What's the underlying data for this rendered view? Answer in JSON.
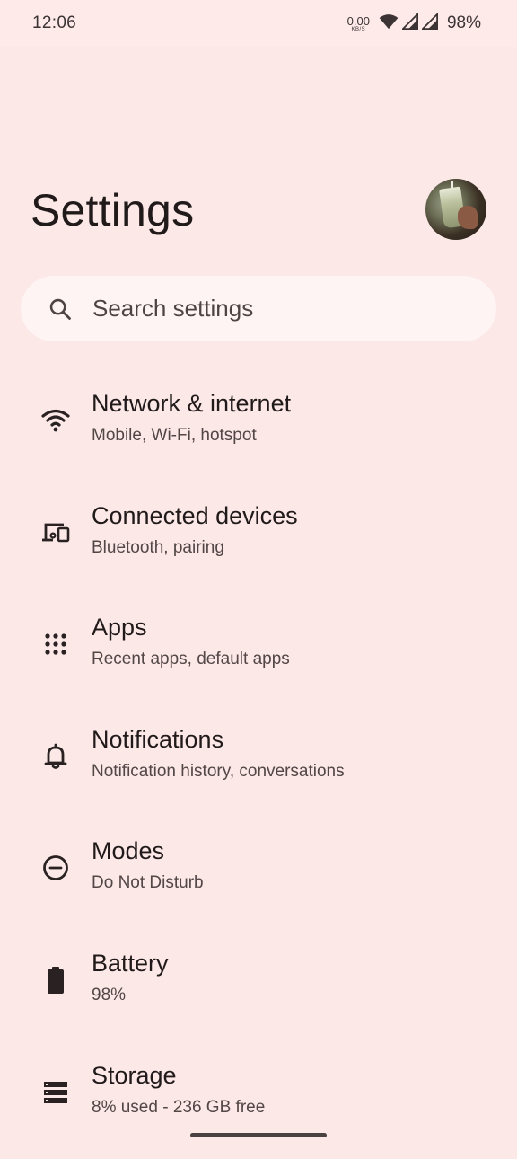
{
  "status_bar": {
    "time": "12:06",
    "net_speed": "0.00",
    "net_speed_unit": "KB/S",
    "battery": "98%"
  },
  "header": {
    "title": "Settings"
  },
  "search": {
    "placeholder": "Search settings"
  },
  "items": [
    {
      "title": "Network & internet",
      "subtitle": "Mobile, Wi-Fi, hotspot",
      "icon": "wifi-icon"
    },
    {
      "title": "Connected devices",
      "subtitle": "Bluetooth, pairing",
      "icon": "devices-icon"
    },
    {
      "title": "Apps",
      "subtitle": "Recent apps, default apps",
      "icon": "apps-grid-icon"
    },
    {
      "title": "Notifications",
      "subtitle": "Notification history, conversations",
      "icon": "bell-icon"
    },
    {
      "title": "Modes",
      "subtitle": "Do Not Disturb",
      "icon": "minus-circle-icon"
    },
    {
      "title": "Battery",
      "subtitle": "98%",
      "icon": "battery-icon"
    },
    {
      "title": "Storage",
      "subtitle": "8% used - 236 GB free",
      "icon": "storage-icon"
    }
  ],
  "colors": {
    "background": "#fbe8e7",
    "search_bg": "#fdf4f3",
    "text_primary": "#211a1a",
    "text_secondary": "#524646"
  }
}
